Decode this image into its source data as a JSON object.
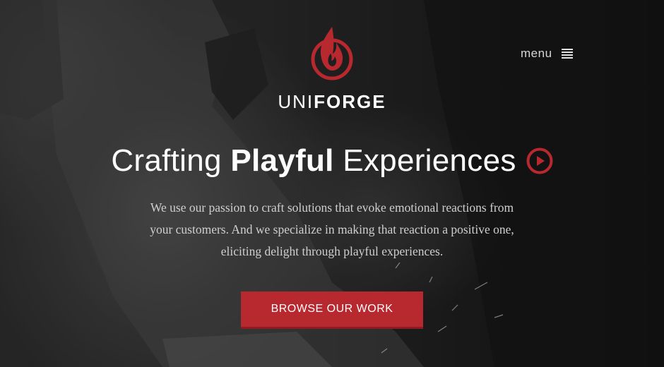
{
  "brand": {
    "name_light": "UNI",
    "name_bold": "FORGE",
    "logo_icon": "flame-in-circle-icon",
    "accent_color": "#b8282f"
  },
  "nav": {
    "menu_label": "menu",
    "menu_icon": "hamburger-icon"
  },
  "hero": {
    "headline_part1": "Crafting ",
    "headline_bold": "Playful",
    "headline_part2": " Experiences",
    "play_icon": "play-circle-icon",
    "intro_lines": [
      "We use our passion to craft solutions that evoke emotional reactions from",
      "your customers. And we specialize in making that reaction a positive one,",
      "eliciting delight through playful experiences."
    ],
    "cta_label": "BROWSE OUR WORK"
  }
}
